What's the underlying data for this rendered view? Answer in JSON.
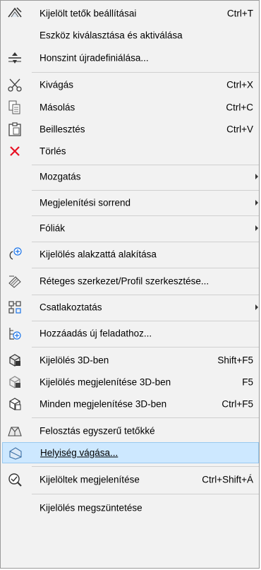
{
  "menu": {
    "items": [
      {
        "label": "Kijelölt tetők beállításai",
        "shortcut": "Ctrl+T",
        "icon": "roof-settings-icon"
      },
      {
        "label": "Eszköz kiválasztása és aktiválása",
        "shortcut": "",
        "icon": ""
      },
      {
        "label": "Honszint újradefiniálása...",
        "shortcut": "",
        "icon": "level-icon"
      },
      {
        "label": "Kivágás",
        "shortcut": "Ctrl+X",
        "icon": "scissors-icon"
      },
      {
        "label": "Másolás",
        "shortcut": "Ctrl+C",
        "icon": "copy-icon"
      },
      {
        "label": "Beillesztés",
        "shortcut": "Ctrl+V",
        "icon": "paste-icon"
      },
      {
        "label": "Törlés",
        "shortcut": "",
        "icon": "delete-x-icon"
      },
      {
        "label": "Mozgatás",
        "shortcut": "",
        "submenu": true
      },
      {
        "label": "Megjelenítési sorrend",
        "shortcut": "",
        "submenu": true
      },
      {
        "label": "Fóliák",
        "shortcut": "",
        "submenu": true
      },
      {
        "label": "Kijelölés alakzattá alakítása",
        "shortcut": "",
        "icon": "convert-shape-icon"
      },
      {
        "label": "Réteges szerkezet/Profil szerkesztése...",
        "shortcut": "",
        "icon": "layered-structure-icon"
      },
      {
        "label": "Csatlakoztatás",
        "shortcut": "",
        "submenu": true,
        "icon": "connect-icon"
      },
      {
        "label": "Hozzáadás új feladathoz...",
        "shortcut": "",
        "icon": "add-task-icon"
      },
      {
        "label": "Kijelölés 3D-ben",
        "shortcut": "Shift+F5",
        "icon": "select-3d-icon"
      },
      {
        "label": "Kijelölés megjelenítése 3D-ben",
        "shortcut": "F5",
        "icon": "show-selection-3d-icon"
      },
      {
        "label": "Minden megjelenítése 3D-ben",
        "shortcut": "Ctrl+F5",
        "icon": "show-all-3d-icon"
      },
      {
        "label": "Felosztás egyszerű tetőkké",
        "shortcut": "",
        "icon": "split-roof-icon"
      },
      {
        "label": "Helyiség vágása...",
        "shortcut": "",
        "icon": "room-cut-icon",
        "highlighted": true
      },
      {
        "label": "Kijelöltek megjelenítése",
        "shortcut": "Ctrl+Shift+Á",
        "icon": "show-selected-icon"
      },
      {
        "label": "Kijelölés megszüntetése",
        "shortcut": "",
        "icon": ""
      }
    ]
  },
  "colors": {
    "highlight": "#cde8ff",
    "highlight_border": "#99c9f0",
    "delete_x": "#e81123",
    "menu_bg": "#f2f2f2"
  }
}
